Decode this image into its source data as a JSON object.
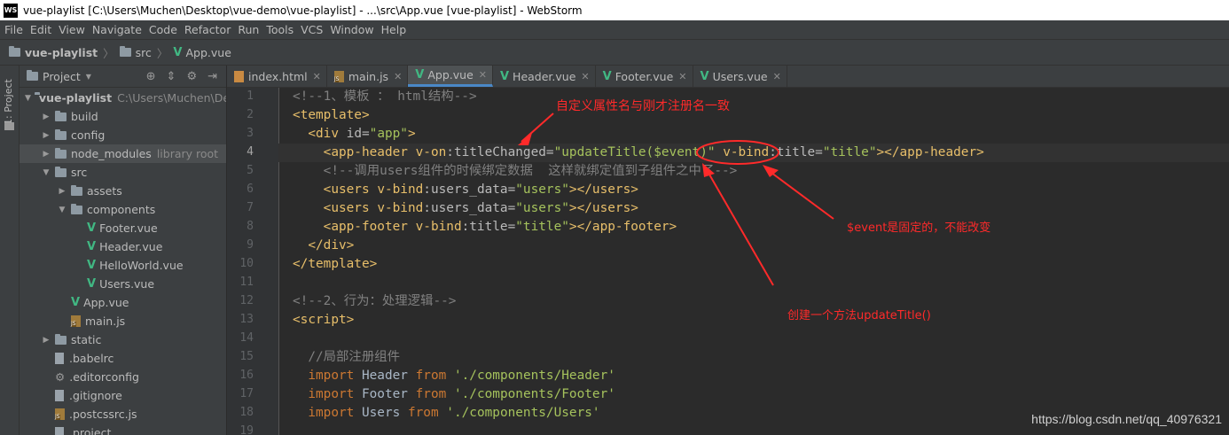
{
  "window": {
    "app_logo": "WS",
    "title": "vue-playlist [C:\\Users\\Muchen\\Desktop\\vue-demo\\vue-playlist] - ...\\src\\App.vue [vue-playlist] - WebStorm"
  },
  "menu": [
    "File",
    "Edit",
    "View",
    "Navigate",
    "Code",
    "Refactor",
    "Run",
    "Tools",
    "VCS",
    "Window",
    "Help"
  ],
  "breadcrumb": [
    "vue-playlist",
    "src",
    "App.vue"
  ],
  "left_stripe": {
    "tab_label": "1: Project"
  },
  "project_panel": {
    "title": "Project",
    "tree": [
      {
        "label": "vue-playlist",
        "hint": "C:\\Users\\Muchen\\De",
        "kind": "folder",
        "open": true
      },
      {
        "label": "build",
        "kind": "folder"
      },
      {
        "label": "config",
        "kind": "folder"
      },
      {
        "label": "node_modules",
        "hint": "library root",
        "kind": "folder"
      },
      {
        "label": "src",
        "kind": "folder",
        "open": true
      },
      {
        "label": "assets",
        "kind": "folder"
      },
      {
        "label": "components",
        "kind": "folder",
        "open": true
      },
      {
        "label": "Footer.vue",
        "kind": "vue"
      },
      {
        "label": "Header.vue",
        "kind": "vue"
      },
      {
        "label": "HelloWorld.vue",
        "kind": "vue"
      },
      {
        "label": "Users.vue",
        "kind": "vue"
      },
      {
        "label": "App.vue",
        "kind": "vue"
      },
      {
        "label": "main.js",
        "kind": "js"
      },
      {
        "label": "static",
        "kind": "folder"
      },
      {
        "label": ".babelrc",
        "kind": "file"
      },
      {
        "label": ".editorconfig",
        "kind": "gear"
      },
      {
        "label": ".gitignore",
        "kind": "file"
      },
      {
        "label": ".postcssrc.js",
        "kind": "js"
      },
      {
        "label": ".project",
        "kind": "file"
      }
    ]
  },
  "tabs": [
    {
      "label": "index.html",
      "kind": "html"
    },
    {
      "label": "main.js",
      "kind": "js"
    },
    {
      "label": "App.vue",
      "kind": "vue",
      "active": true
    },
    {
      "label": "Header.vue",
      "kind": "vue"
    },
    {
      "label": "Footer.vue",
      "kind": "vue"
    },
    {
      "label": "Users.vue",
      "kind": "vue"
    }
  ],
  "editor": {
    "line_numbers": [
      "1",
      "2",
      "3",
      "4",
      "5",
      "6",
      "7",
      "8",
      "9",
      "10",
      "11",
      "12",
      "13",
      "14",
      "15",
      "16",
      "17",
      "18",
      "19"
    ],
    "lines": [
      [
        {
          "t": "<!--1、模板 ： html结构-->",
          "c": "c-comment"
        }
      ],
      [
        {
          "t": "<template>",
          "c": "c-tag"
        }
      ],
      [
        {
          "t": "  <div ",
          "c": "c-tag"
        },
        {
          "t": "id=",
          "c": "c-attr"
        },
        {
          "t": "\"app\"",
          "c": "c-str"
        },
        {
          "t": ">",
          "c": "c-tag"
        }
      ],
      [
        {
          "t": "    <app-header ",
          "c": "c-tag"
        },
        {
          "t": "v-on",
          "c": "c-vdir"
        },
        {
          "t": ":titleChanged=",
          "c": "c-attr"
        },
        {
          "t": "\"updateTitle($event)\"",
          "c": "c-str"
        },
        {
          "t": " v-bind",
          "c": "c-vdir"
        },
        {
          "t": ":title=",
          "c": "c-attr"
        },
        {
          "t": "\"title\"",
          "c": "c-str"
        },
        {
          "t": "></app-header>",
          "c": "c-tag"
        }
      ],
      [
        {
          "t": "    <!--调用users组件的时候绑定数据  这样就绑定值到子组件之中了-->",
          "c": "c-comment"
        }
      ],
      [
        {
          "t": "    <users ",
          "c": "c-tag"
        },
        {
          "t": "v-bind",
          "c": "c-vdir"
        },
        {
          "t": ":users_data=",
          "c": "c-attr"
        },
        {
          "t": "\"users\"",
          "c": "c-str"
        },
        {
          "t": "></users>",
          "c": "c-tag"
        }
      ],
      [
        {
          "t": "    <users ",
          "c": "c-tag"
        },
        {
          "t": "v-bind",
          "c": "c-vdir"
        },
        {
          "t": ":users_data=",
          "c": "c-attr"
        },
        {
          "t": "\"users\"",
          "c": "c-str"
        },
        {
          "t": "></users>",
          "c": "c-tag"
        }
      ],
      [
        {
          "t": "    <app-footer ",
          "c": "c-tag"
        },
        {
          "t": "v-bind",
          "c": "c-vdir"
        },
        {
          "t": ":title=",
          "c": "c-attr"
        },
        {
          "t": "\"title\"",
          "c": "c-str"
        },
        {
          "t": "></app-footer>",
          "c": "c-tag"
        }
      ],
      [
        {
          "t": "  </div>",
          "c": "c-tag"
        }
      ],
      [
        {
          "t": "</template>",
          "c": "c-tag"
        }
      ],
      [
        {
          "t": "",
          "c": "c-text"
        }
      ],
      [
        {
          "t": "<!--2、行为：处理逻辑-->",
          "c": "c-comment"
        }
      ],
      [
        {
          "t": "<script>",
          "c": "c-tag"
        }
      ],
      [
        {
          "t": "",
          "c": "c-text"
        }
      ],
      [
        {
          "t": "  //局部注册组件",
          "c": "c-comment"
        }
      ],
      [
        {
          "t": "  import ",
          "c": "c-kw"
        },
        {
          "t": "Header ",
          "c": "c-text"
        },
        {
          "t": "from ",
          "c": "c-kw"
        },
        {
          "t": "'./components/Header'",
          "c": "c-str"
        }
      ],
      [
        {
          "t": "  import ",
          "c": "c-kw"
        },
        {
          "t": "Footer ",
          "c": "c-text"
        },
        {
          "t": "from ",
          "c": "c-kw"
        },
        {
          "t": "'./components/Footer'",
          "c": "c-str"
        }
      ],
      [
        {
          "t": "  import ",
          "c": "c-kw"
        },
        {
          "t": "Users ",
          "c": "c-text"
        },
        {
          "t": "from ",
          "c": "c-kw"
        },
        {
          "t": "'./components/Users'",
          "c": "c-str"
        }
      ],
      [
        {
          "t": "",
          "c": "c-text"
        }
      ]
    ]
  },
  "annotations": {
    "note1": "自定义属性名与刚才注册名一致",
    "note2": "$event是固定的，不能改变",
    "note3": "创建一个方法updateTitle()",
    "color": "#ff2a2a"
  },
  "watermark": "https://blog.csdn.net/qq_40976321"
}
